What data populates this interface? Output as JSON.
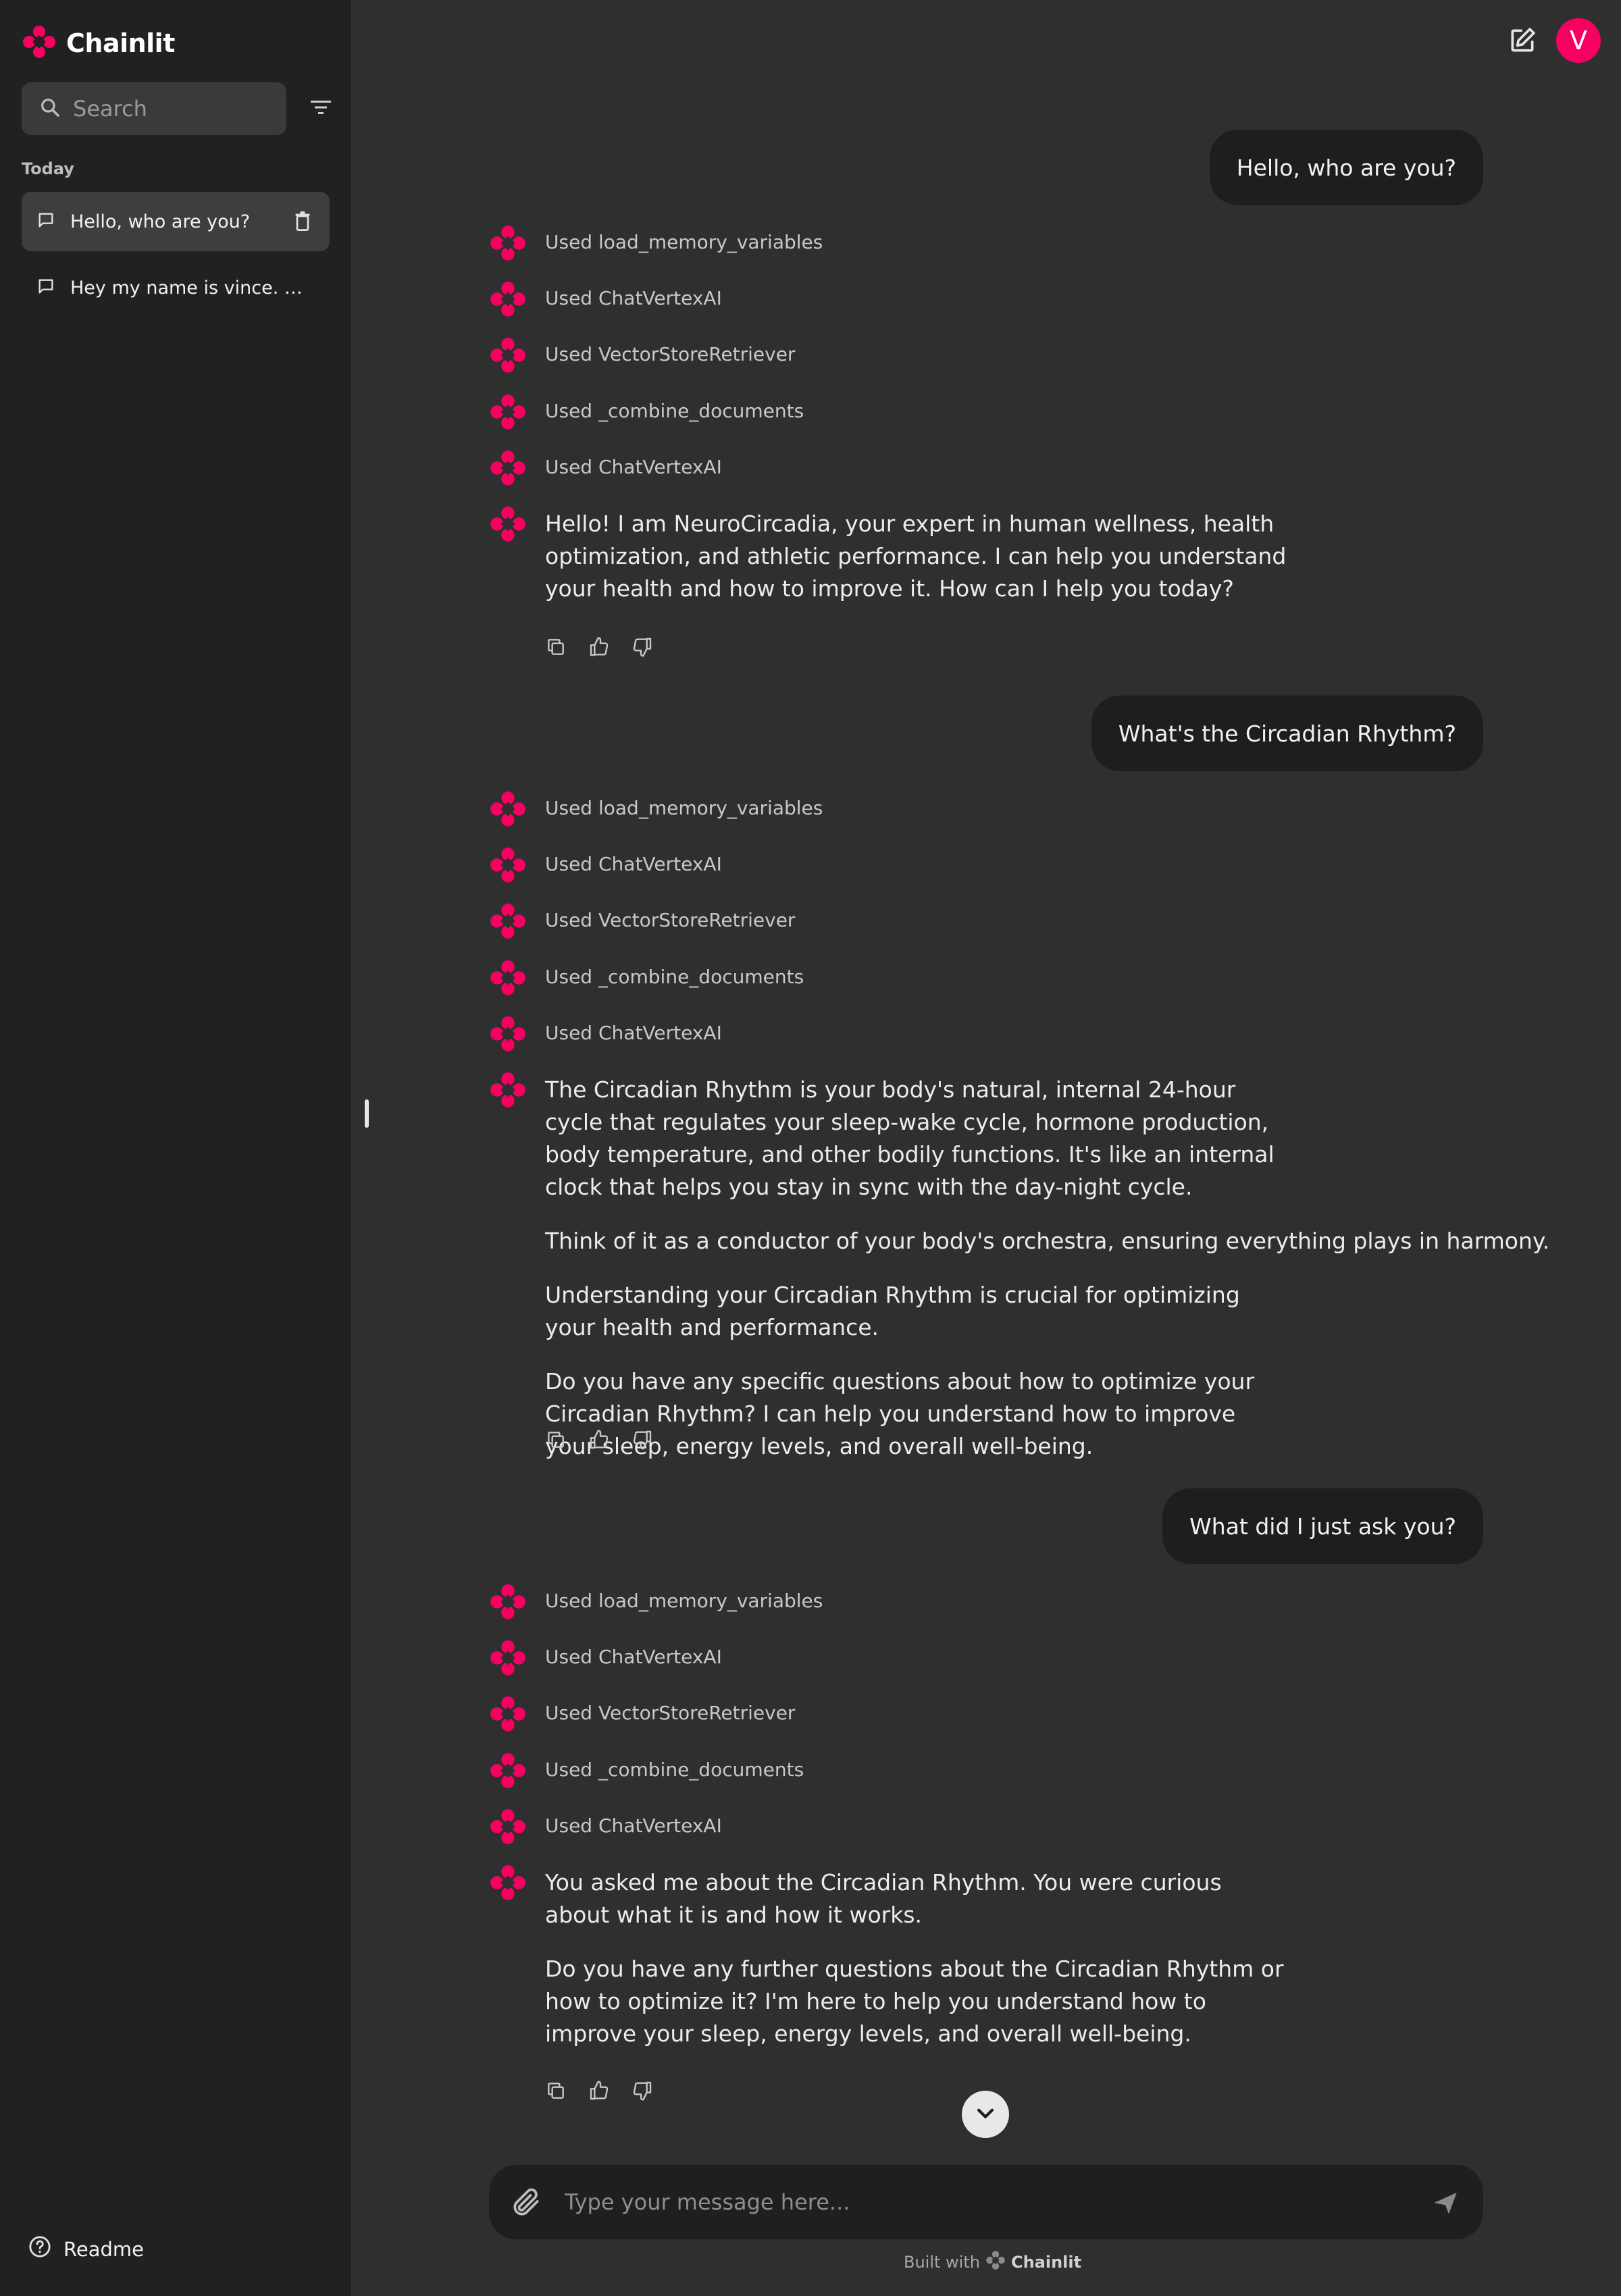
{
  "app": {
    "brand": "Chainlit",
    "accent_color": "#F80061"
  },
  "sidebar": {
    "search_placeholder": "Search",
    "section_label": "Today",
    "threads": [
      {
        "label": "Hello, who are you?",
        "active": true
      },
      {
        "label": "Hey my name is vince. wh..."
      }
    ],
    "readme_label": "Readme"
  },
  "header": {
    "avatar_letter": "V"
  },
  "conversation": [
    {
      "user": "Hello, who are you?",
      "steps": [
        "Used load_memory_variables",
        "Used ChatVertexAI",
        "Used VectorStoreRetriever",
        "Used _combine_documents",
        "Used ChatVertexAI"
      ],
      "assistant": [
        "Hello! I am NeuroCircadia, your expert in human wellness, health optimization, and athletic performance. I can help you understand your health and how to improve it. How can I help you today?"
      ]
    },
    {
      "user": "What's the Circadian Rhythm?",
      "steps": [
        "Used load_memory_variables",
        "Used ChatVertexAI",
        "Used VectorStoreRetriever",
        "Used _combine_documents",
        "Used ChatVertexAI"
      ],
      "assistant": [
        "The Circadian Rhythm is your body's natural, internal 24-hour cycle that regulates your sleep-wake cycle, hormone production, body temperature, and other bodily functions. It's like an internal clock that helps you stay in sync with the day-night cycle.",
        "Think of it as a conductor of your body's orchestra, ensuring everything plays in harmony.",
        "Understanding your Circadian Rhythm is crucial for optimizing your health and performance.",
        "Do you have any specific questions about how to optimize your Circadian Rhythm? I can help you understand how to improve your sleep, energy levels, and overall well-being."
      ]
    },
    {
      "user": "What did I just ask you?",
      "steps": [
        "Used load_memory_variables",
        "Used ChatVertexAI",
        "Used VectorStoreRetriever",
        "Used _combine_documents",
        "Used ChatVertexAI"
      ],
      "assistant": [
        "You asked me about the Circadian Rhythm. You were curious about what it is and how it works.",
        "Do you have any further questions about the Circadian Rhythm or how to optimize it? I'm here to help you understand how to improve your sleep, energy levels, and overall well-being."
      ]
    }
  ],
  "composer": {
    "placeholder": "Type your message here..."
  },
  "footer": {
    "built_with": "Built with",
    "brand": "Chainlit"
  }
}
